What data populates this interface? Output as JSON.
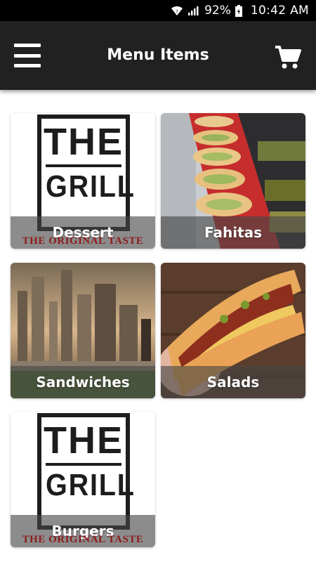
{
  "status_bar": {
    "battery": "92%",
    "time": "10:42 AM"
  },
  "app_bar": {
    "title": "Menu Items",
    "menu_icon": "hamburger-menu-icon",
    "cart_icon": "shopping-cart-icon"
  },
  "logo": {
    "line1": "THE",
    "line2": "GRILL",
    "tagline": "THE ORIGINAL TASTE"
  },
  "categories": [
    {
      "label": "Dessert",
      "image": "the-grill-logo"
    },
    {
      "label": "Fahitas",
      "image": "sandwich-rolls-photo"
    },
    {
      "label": "Sandwiches",
      "image": "city-skyline-photo"
    },
    {
      "label": "Salads",
      "image": "hot-dog-photo"
    },
    {
      "label": "Burgers",
      "image": "the-grill-logo"
    }
  ],
  "colors": {
    "app_bar": "#212121",
    "status_bar": "#000000",
    "caption_overlay": "rgba(70,70,70,0.62)",
    "logo_tagline": "#8e1b1b"
  }
}
